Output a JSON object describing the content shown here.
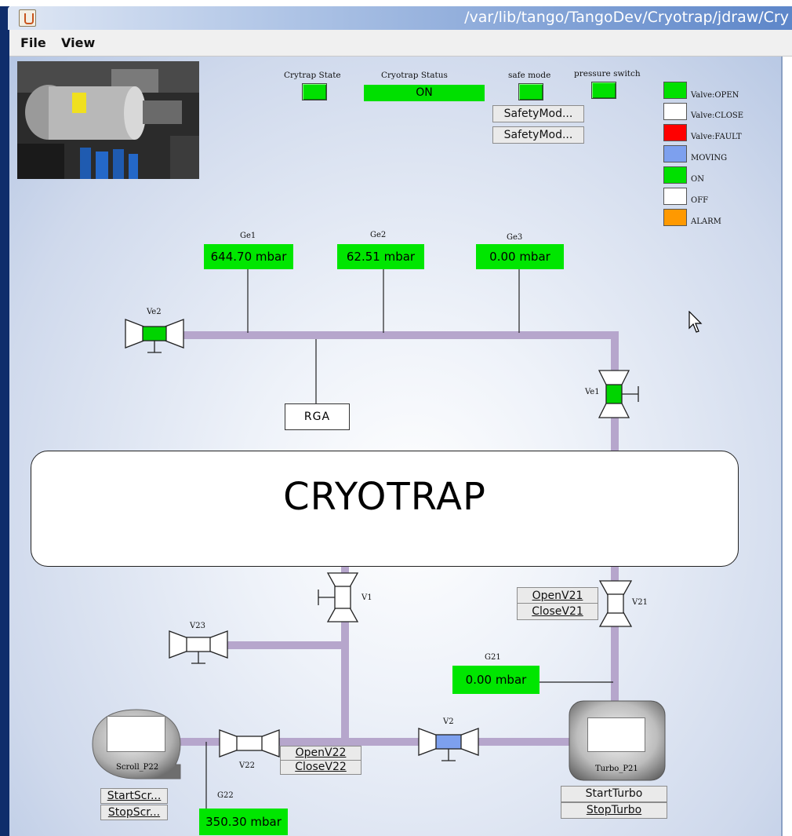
{
  "window": {
    "title": "/var/lib/tango/TangoDev/Cryotrap/jdraw/Cry"
  },
  "menu": {
    "file": "File",
    "view": "View"
  },
  "status_panel": {
    "cryotrap_state_label": "Crytrap State",
    "cryotrap_status_label": "Cryotrap Status",
    "cryotrap_status_value": "ON",
    "safe_mode_label": "safe mode",
    "pressure_switch_label": "pressure switch",
    "safety_buttons": [
      "SafetyMod...",
      "SafetyMod..."
    ]
  },
  "legend": [
    {
      "color": "#00e000",
      "label": "Valve:OPEN"
    },
    {
      "color": "#ffffff",
      "label": "Valve:CLOSE"
    },
    {
      "color": "#ff0000",
      "label": "Valve:FAULT"
    },
    {
      "color": "#7da0ee",
      "label": "MOVING"
    },
    {
      "color": "#00e000",
      "label": "ON"
    },
    {
      "color": "#ffffff",
      "label": "OFF"
    },
    {
      "color": "#ff9900",
      "label": "ALARM"
    }
  ],
  "gauges": {
    "ge1": {
      "label": "Ge1",
      "value": "644.70 mbar"
    },
    "ge2": {
      "label": "Ge2",
      "value": "62.51 mbar"
    },
    "ge3": {
      "label": "Ge3",
      "value": "0.00 mbar"
    },
    "g21": {
      "label": "G21",
      "value": "0.00 mbar"
    },
    "g22": {
      "label": "G22",
      "value": "350.30 mbar"
    }
  },
  "valves": {
    "ve2": "Ve2",
    "ve1": "Ve1",
    "v1": "V1",
    "v21": "V21",
    "v23": "V23",
    "v22": "V22",
    "v2": "V2"
  },
  "components": {
    "rga": "RGA",
    "cryotrap": "CRYOTRAP",
    "scroll_pump": "Scroll_P22",
    "turbo_pump": "Turbo_P21"
  },
  "buttons": {
    "open_v21": "OpenV21",
    "close_v21": "CloseV21",
    "open_v22": "OpenV22",
    "close_v22": "CloseV22",
    "start_scroll": "StartScr...",
    "stop_scroll": "StopScr...",
    "start_turbo": "StartTurbo",
    "stop_turbo": "StopTurbo"
  }
}
